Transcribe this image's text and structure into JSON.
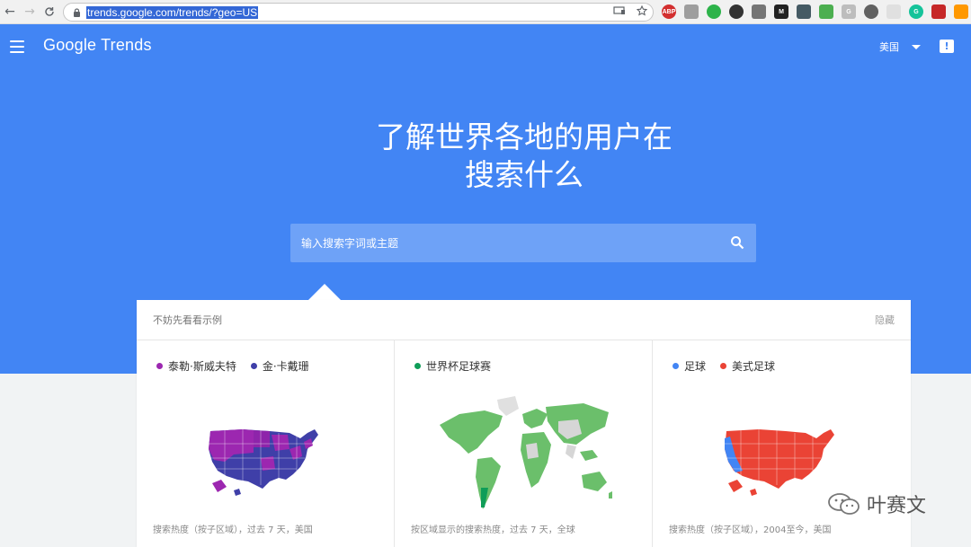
{
  "browser": {
    "url": "trends.google.com/trends/?geo=US",
    "nav_back": "←",
    "nav_forward": "→",
    "nav_reload": "C"
  },
  "header": {
    "logo": "Google Trends",
    "region": "美国"
  },
  "hero": {
    "headline_line1": "了解世界各地的用户在",
    "headline_line2": "搜索什么",
    "search_placeholder": "输入搜索字词或主题"
  },
  "examples": {
    "title": "不妨先看看示例",
    "hide_label": "隐藏",
    "cards": [
      {
        "legend": [
          {
            "label": "泰勒·斯威夫特",
            "color": "#9c27b0"
          },
          {
            "label": "金·卡戴珊",
            "color": "#3f3fa8"
          }
        ],
        "footer": "搜索热度（按子区域），过去 7 天，美国"
      },
      {
        "legend": [
          {
            "label": "世界杯足球赛",
            "color": "#0f9d58"
          }
        ],
        "footer": "按区域显示的搜索热度，过去 7 天，全球"
      },
      {
        "legend": [
          {
            "label": "足球",
            "color": "#4285f4"
          },
          {
            "label": "美式足球",
            "color": "#ea4335"
          }
        ],
        "footer": "搜索热度（按子区域），2004至今，美国"
      }
    ]
  },
  "watermark": {
    "text": "叶赛文"
  },
  "colors": {
    "brand_blue": "#4285f4",
    "map_purple": "#9c27b0",
    "map_navy": "#3f3fa8",
    "map_green": "#6bbf6b",
    "map_red": "#ea4335"
  }
}
